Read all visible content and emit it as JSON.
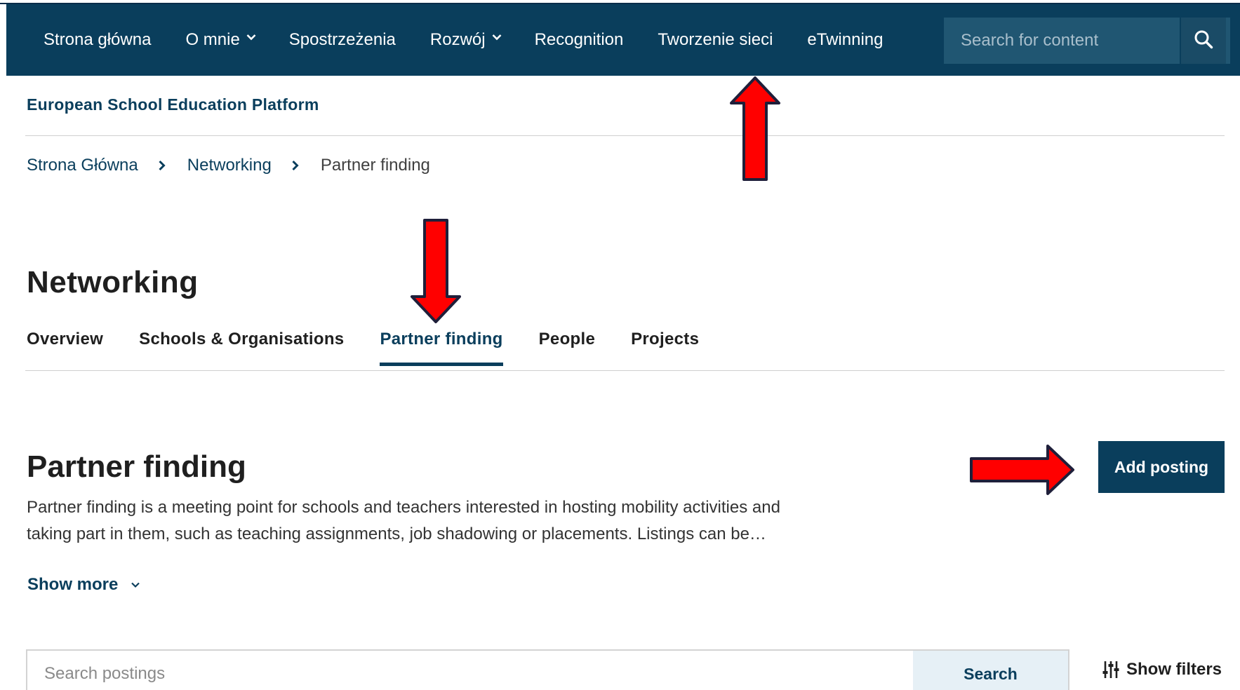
{
  "nav": {
    "items": [
      {
        "label": "Strona główna",
        "has_dropdown": false
      },
      {
        "label": "O mnie",
        "has_dropdown": true
      },
      {
        "label": "Spostrzeżenia",
        "has_dropdown": false
      },
      {
        "label": "Rozwój",
        "has_dropdown": true
      },
      {
        "label": "Recognition",
        "has_dropdown": false
      },
      {
        "label": "Tworzenie sieci",
        "has_dropdown": false
      },
      {
        "label": "eTwinning",
        "has_dropdown": false
      }
    ],
    "search_placeholder": "Search for content",
    "search_icon": "search-icon"
  },
  "site_title": "European School Education Platform",
  "breadcrumb": {
    "items": [
      "Strona Główna",
      "Networking"
    ],
    "current": "Partner finding"
  },
  "page_title": "Networking",
  "tabs": [
    {
      "label": "Overview",
      "active": false
    },
    {
      "label": "Schools & Organisations",
      "active": false
    },
    {
      "label": "Partner finding",
      "active": true
    },
    {
      "label": "People",
      "active": false
    },
    {
      "label": "Projects",
      "active": false
    }
  ],
  "section": {
    "title": "Partner finding",
    "description": "Partner finding is a meeting point for schools and teachers interested in hosting mobility activities and taking part in them, such as teaching assignments, job shadowing or placements. Listings can be…",
    "add_button": "Add posting",
    "show_more": "Show more"
  },
  "postings_search": {
    "placeholder": "Search postings",
    "button": "Search"
  },
  "show_filters": "Show filters",
  "colors": {
    "brand": "#0a3e5c",
    "annotation_arrow": "#ff0000"
  }
}
